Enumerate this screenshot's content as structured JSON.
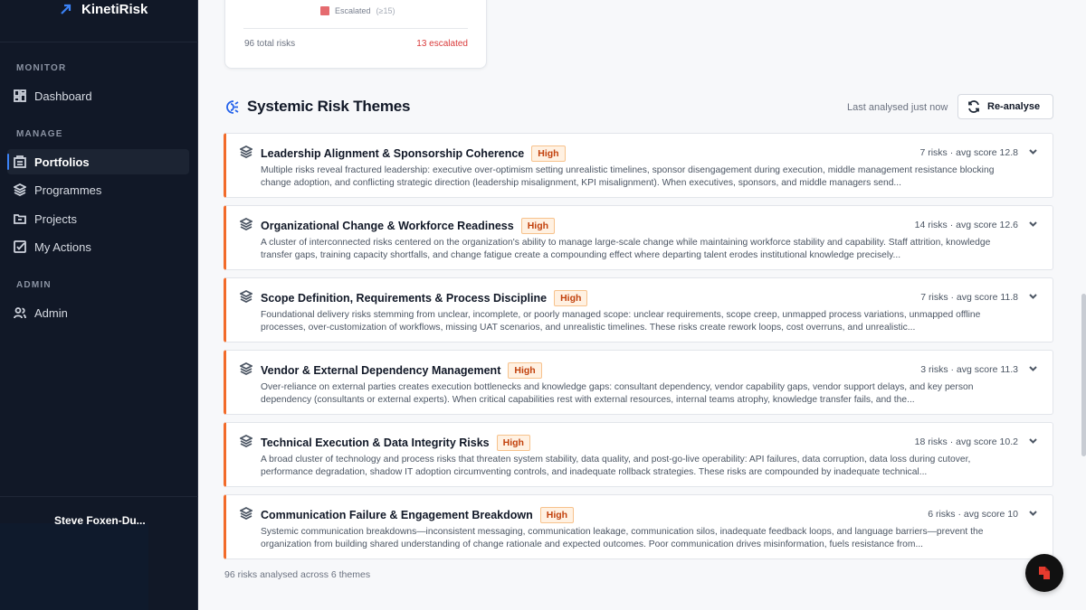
{
  "brand": {
    "name": "KinetiRisk"
  },
  "sidebar": {
    "sections": [
      {
        "label": "MONITOR"
      },
      {
        "label": "MANAGE"
      },
      {
        "label": "ADMIN"
      }
    ],
    "items": [
      {
        "label": "Dashboard",
        "icon": "dashboard-icon"
      },
      {
        "label": "Portfolios",
        "icon": "portfolio-icon",
        "active": true
      },
      {
        "label": "Programmes",
        "icon": "layers-icon"
      },
      {
        "label": "Projects",
        "icon": "folder-icon"
      },
      {
        "label": "My Actions",
        "icon": "check-square-icon"
      },
      {
        "label": "Admin",
        "icon": "users-icon"
      }
    ],
    "user": {
      "name": "Steve Foxen-Du..."
    }
  },
  "summary": {
    "legend_label": "Escalated",
    "legend_threshold": "(≥15)",
    "total": "96 total risks",
    "escalated": "13 escalated",
    "escalated_color": "#d93a3a"
  },
  "themes_section": {
    "title": "Systemic Risk Themes",
    "last_analysed": "Last analysed just now",
    "reanalyse_label": "Re-analyse",
    "themes": [
      {
        "title": "Leadership Alignment & Sponsorship Coherence",
        "severity": "High",
        "meta": "7 risks · avg score 12.8",
        "description": "Multiple risks reveal fractured leadership: executive over-optimism setting unrealistic timelines, sponsor disengagement during execution, middle management resistance blocking change adoption, and conflicting strategic direction (leadership misalignment, KPI misalignment). When executives, sponsors, and middle managers send..."
      },
      {
        "title": "Organizational Change & Workforce Readiness",
        "severity": "High",
        "meta": "14 risks · avg score 12.6",
        "description": "A cluster of interconnected risks centered on the organization's ability to manage large-scale change while maintaining workforce stability and capability. Staff attrition, knowledge transfer gaps, training capacity shortfalls, and change fatigue create a compounding effect where departing talent erodes institutional knowledge precisely..."
      },
      {
        "title": "Scope Definition, Requirements & Process Discipline",
        "severity": "High",
        "meta": "7 risks · avg score 11.8",
        "description": "Foundational delivery risks stemming from unclear, incomplete, or poorly managed scope: unclear requirements, scope creep, unmapped process variations, unmapped offline processes, over-customization of workflows, missing UAT scenarios, and unrealistic timelines. These risks create rework loops, cost overruns, and unrealistic..."
      },
      {
        "title": "Vendor & External Dependency Management",
        "severity": "High",
        "meta": "3 risks · avg score 11.3",
        "description": "Over-reliance on external parties creates execution bottlenecks and knowledge gaps: consultant dependency, vendor capability gaps, vendor support delays, and key person dependency (consultants or external experts). When critical capabilities rest with external resources, internal teams atrophy, knowledge transfer fails, and the..."
      },
      {
        "title": "Technical Execution & Data Integrity Risks",
        "severity": "High",
        "meta": "18 risks · avg score 10.2",
        "description": "A broad cluster of technology and process risks that threaten system stability, data quality, and post-go-live operability: API failures, data corruption, data loss during cutover, performance degradation, shadow IT adoption circumventing controls, and inadequate rollback strategies. These risks are compounded by inadequate technical..."
      },
      {
        "title": "Communication Failure & Engagement Breakdown",
        "severity": "High",
        "meta": "6 risks · avg score 10",
        "description": "Systemic communication breakdowns—inconsistent messaging, communication leakage, communication silos, inadequate feedback loops, and language barriers—prevent the organization from building shared understanding of change rationale and expected outcomes. Poor communication drives misinformation, fuels resistance from..."
      }
    ],
    "footer": "96 risks analysed across 6 themes"
  },
  "colors": {
    "sidebar_bg": "#111827",
    "accent": "#2563eb",
    "theme_border": "#f26b2a",
    "badge_text": "#c2410c"
  }
}
